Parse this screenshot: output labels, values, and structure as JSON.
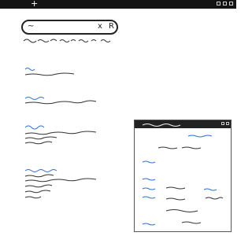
{
  "window": {
    "new_tab_label": "+"
  },
  "search": {
    "value": "~",
    "clear_label": "x",
    "mic_label": "R"
  },
  "colors": {
    "link": "#2a6fd6",
    "text": "#222222",
    "topbar": "#141414"
  },
  "icons": [
    "plus-icon",
    "close-icon",
    "microphone-icon",
    "minimize-icon",
    "maximize-icon"
  ]
}
